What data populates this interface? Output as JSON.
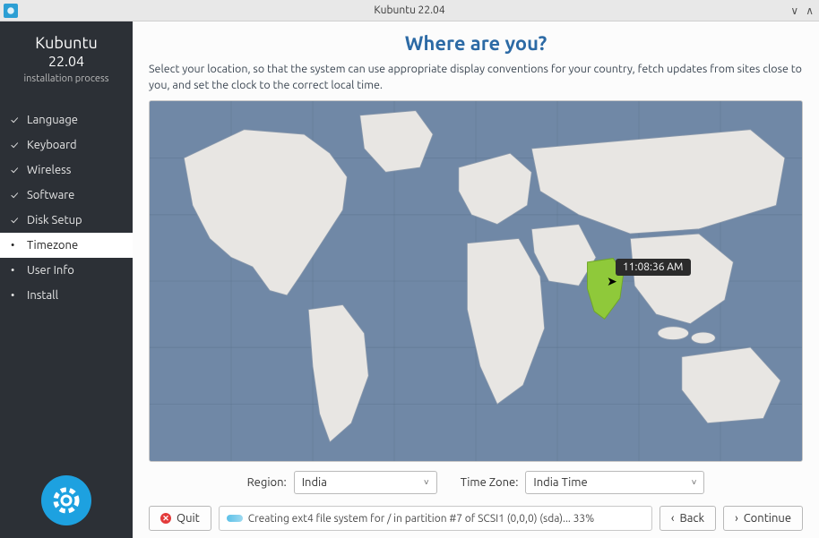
{
  "window": {
    "title": "Kubuntu 22.04"
  },
  "sidebar": {
    "brand_name": "Kubuntu",
    "brand_version": "22.04",
    "brand_subtitle": "installation process",
    "steps": [
      {
        "label": "Language",
        "state": "done"
      },
      {
        "label": "Keyboard",
        "state": "done"
      },
      {
        "label": "Wireless",
        "state": "done"
      },
      {
        "label": "Software",
        "state": "done"
      },
      {
        "label": "Disk Setup",
        "state": "done"
      },
      {
        "label": "Timezone",
        "state": "active"
      },
      {
        "label": "User Info",
        "state": "pending"
      },
      {
        "label": "Install",
        "state": "pending"
      }
    ]
  },
  "page": {
    "title": "Where are you?",
    "instructions": "Select your location, so that the system can use appropriate display conventions for your country, fetch updates from sites close to you, and set the clock to the correct local time."
  },
  "map": {
    "tooltip_time": "11:08:36 AM",
    "highlight_country": "India"
  },
  "region": {
    "label": "Region:",
    "value": "India"
  },
  "timezone": {
    "label": "Time Zone:",
    "value": "India Time"
  },
  "buttons": {
    "quit": "Quit",
    "back": "Back",
    "continue": "Continue"
  },
  "progress": {
    "message": "Creating ext4 file system for / in partition #7 of SCSI1 (0,0,0) (sda)... 33%"
  }
}
